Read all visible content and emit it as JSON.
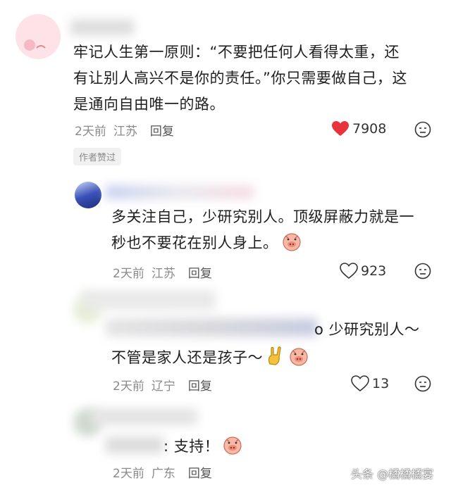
{
  "comments": [
    {
      "text_lines": [
        "牢记人生第一原则：“不要把任何人看得太重，还",
        "有让别人高兴不是你的责任。”你只需要做自己，这",
        "是通向自由唯一的路。"
      ],
      "time": "2天前",
      "location": "江苏",
      "reply": "回复",
      "likes": "7908",
      "liked": true,
      "badge": "作者赞过"
    },
    {
      "text_lines": [
        "多关注自己，少研究别人。顶级屏蔽力就是一",
        "秒也不要花在别人身上。"
      ],
      "time": "2天前",
      "location": "江苏",
      "reply": "回复",
      "likes": "923"
    },
    {
      "text_lines": [
        "o 少研究别人～",
        "不管是家人还是孩子～"
      ],
      "time": "2天前",
      "location": "辽宁",
      "reply": "回复",
      "likes": "13"
    },
    {
      "text_lines": [
        ": 支持！"
      ],
      "time": "2天前",
      "location": "广东",
      "reply": "回复"
    }
  ],
  "watermark": "头条 @橘橘橘宴",
  "colors": {
    "liked_heart": "#e8333a",
    "meta_gray": "#8a8a8a"
  },
  "icons": [
    "heart-icon",
    "dislike-face-icon",
    "pig-emoji-icon",
    "rock-hand-emoji-icon"
  ]
}
